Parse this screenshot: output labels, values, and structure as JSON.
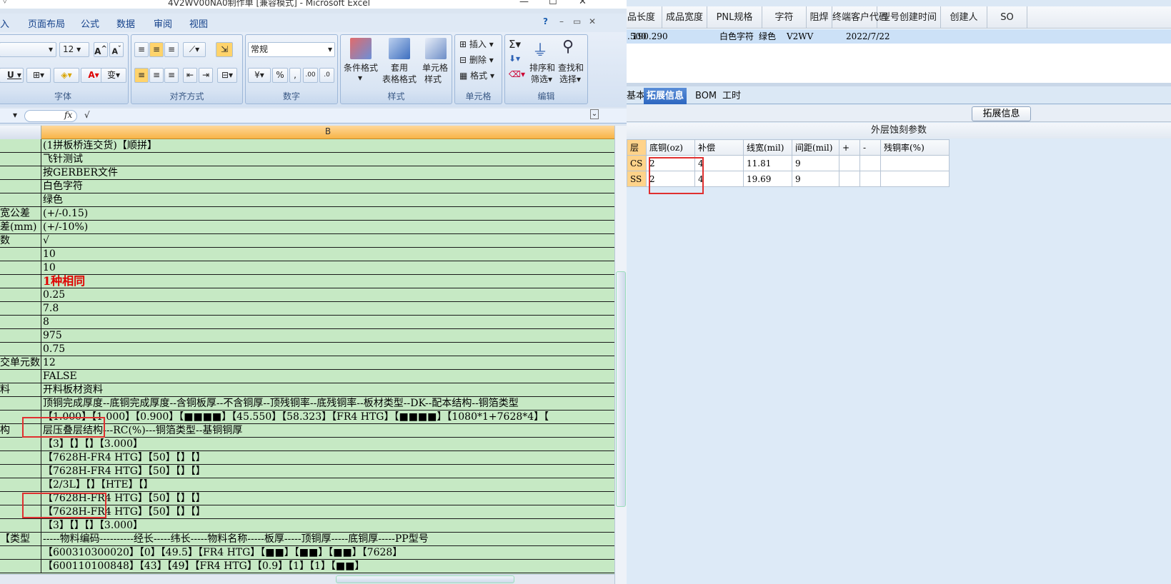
{
  "excel": {
    "title": "4V2WV00NA0制作单 [兼容模式] - Microsoft Excel",
    "menu": [
      "入",
      "页面布局",
      "公式",
      "数据",
      "审阅",
      "视图"
    ],
    "font_size": "12",
    "number_format": "常规",
    "groups": {
      "font": "字体",
      "align": "对齐方式",
      "number": "数字",
      "styles": "样式",
      "cells": "单元格",
      "edit": "编辑"
    },
    "buttons": {
      "cond_format": "条件格式",
      "table_format_1": "套用",
      "table_format_2": "表格格式",
      "cell_style_1": "单元格",
      "cell_style_2": "样式",
      "insert": "插入",
      "delete": "删除",
      "format": "格式",
      "sort_1": "排序和",
      "sort_2": "筛选",
      "find_1": "查找和",
      "find_2": "选择"
    },
    "formula": "√",
    "column_b": "B",
    "rows": [
      {
        "a": "",
        "b": "(1拼板桥连交货)【顺拼】"
      },
      {
        "a": "",
        "b": "飞针测试"
      },
      {
        "a": "",
        "b": "按GERBER文件"
      },
      {
        "a": "",
        "b": "白色字符"
      },
      {
        "a": "",
        "b": "绿色"
      },
      {
        "a": "宽公差",
        "b": "(+/-0.15)"
      },
      {
        "a": "差(mm)",
        "b": "(+/-10%)"
      },
      {
        "a": "数",
        "b": "√"
      },
      {
        "a": "",
        "b": "10"
      },
      {
        "a": "",
        "b": "10"
      },
      {
        "a": "",
        "b": "1种相同",
        "red": true
      },
      {
        "a": "",
        "b": "0.25"
      },
      {
        "a": "",
        "b": "7.8"
      },
      {
        "a": "",
        "b": "8"
      },
      {
        "a": "",
        "b": "975"
      },
      {
        "a": "",
        "b": "0.75"
      },
      {
        "a": "交单元数",
        "b": "12"
      },
      {
        "a": "",
        "b": "FALSE"
      },
      {
        "a": "料",
        "b": "开料板材资料"
      },
      {
        "a": "",
        "b": "顶铜完成厚度--底铜完成厚度--含铜板厚--不含铜厚--顶残铜率--底残铜率--板材类型--DK--配本结构--铜箔类型"
      },
      {
        "a": "",
        "b": "【1.000】【1.000】【0.900】【■■■■】【45.550】【58.323】【FR4 HTG】【■■■■】【1080*1+7628*4】【"
      },
      {
        "a": "构",
        "b": "层压叠层结构---RC(%)---铜箔类型--基铜铜厚"
      },
      {
        "a": "",
        "b": "【3】【】【】【3.000】"
      },
      {
        "a": "",
        "b": "【7628H-FR4 HTG】【50】【】【】"
      },
      {
        "a": "",
        "b": "【7628H-FR4 HTG】【50】【】【】"
      },
      {
        "a": "",
        "b": "【2/3L】【】【HTE】【】"
      },
      {
        "a": "",
        "b": "【7628H-FR4 HTG】【50】【】【】"
      },
      {
        "a": "",
        "b": "【7628H-FR4 HTG】【50】【】【】"
      },
      {
        "a": "",
        "b": "【3】【】【】【3.000】"
      },
      {
        "a": "类型】",
        "b": "-----物料编码----------经长-----纬长-----物料名称-----板厚-----顶铜厚-----底铜厚-----PP型号"
      },
      {
        "a": "",
        "b": "【600310300020】【0】【49.5】【FR4 HTG】【■■】【■■】【■■】【7628】"
      },
      {
        "a": "",
        "b": "【600110100848】【43】【49】【FR4 HTG】【0.9】【1】【1】【■■】"
      }
    ]
  },
  "erp": {
    "headers": [
      "品长度",
      "成品宽度",
      "PNL规格",
      "字符",
      "阻焊",
      "终端客户代码",
      "型号创建时间",
      "创建人",
      "SO"
    ],
    "row": [
      ".500",
      "190.290",
      "",
      "白色字符",
      "绿色",
      "V2WV",
      "2022/7/22",
      "",
      ""
    ],
    "tabs": [
      "基本信息",
      "拓展信息",
      "BOM",
      "工时"
    ],
    "active_tab": "拓展信息",
    "sub_button": "拓展信息",
    "panel_title": "外层蚀刻参数",
    "etch_headers": [
      "层",
      "底铜(oz)",
      "补偿",
      "线宽(mil)",
      "间距(mil)",
      "+",
      "-",
      "残铜率(%)"
    ],
    "etch_rows": [
      [
        "CS",
        "2",
        "4",
        "11.81",
        "9",
        "",
        "",
        ""
      ],
      [
        "SS",
        "2",
        "4",
        "19.69",
        "9",
        "",
        "",
        ""
      ]
    ]
  }
}
